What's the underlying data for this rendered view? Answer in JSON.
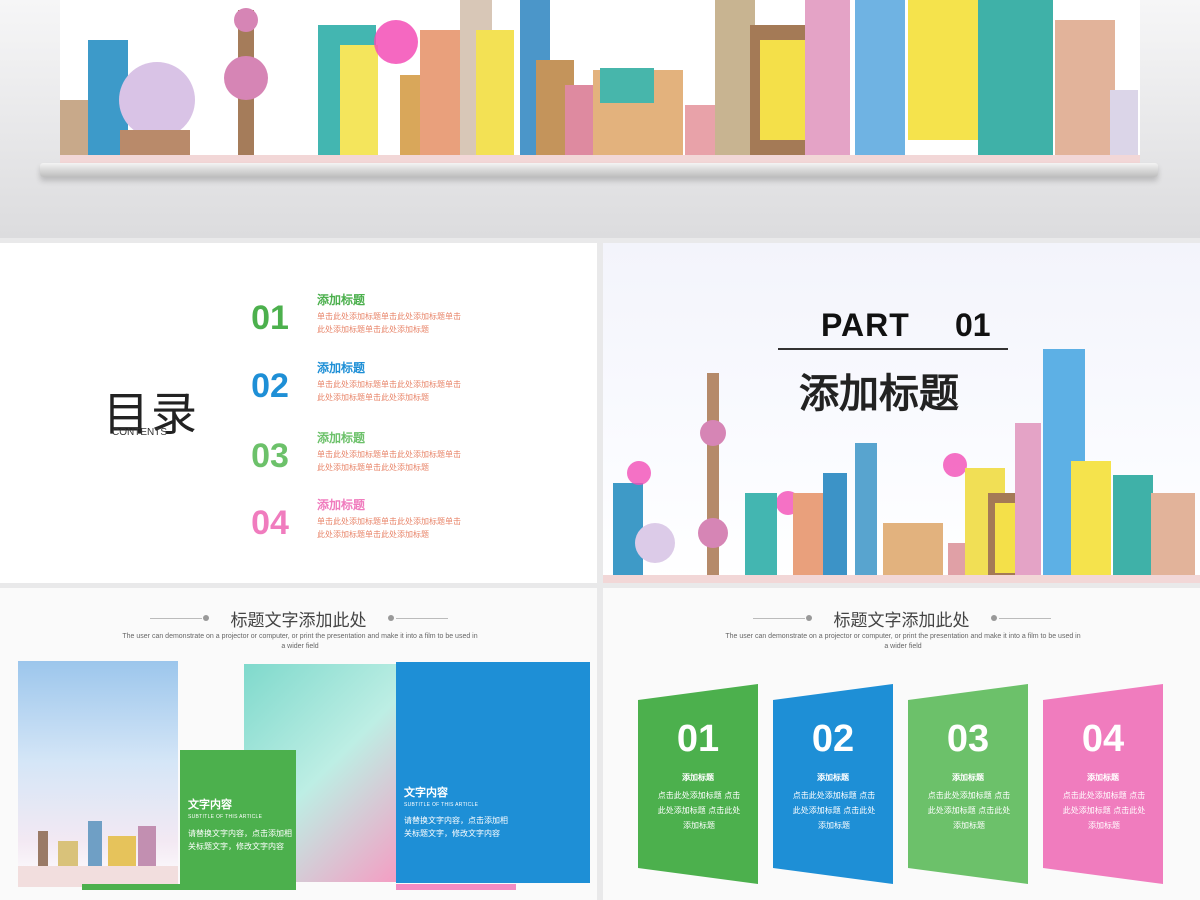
{
  "toc": {
    "title": "目录",
    "subtitle": "CONTENTS",
    "items": [
      {
        "num": "01",
        "heading": "添加标题",
        "desc": "单击此处添加标题单击此处添加标题单击此处添加标题单击此处添加标题",
        "color": "#4cb04d"
      },
      {
        "num": "02",
        "heading": "添加标题",
        "desc": "单击此处添加标题单击此处添加标题单击此处添加标题单击此处添加标题",
        "color": "#1e8fd6"
      },
      {
        "num": "03",
        "heading": "添加标题",
        "desc": "单击此处添加标题单击此处添加标题单击此处添加标题单击此处添加标题",
        "color": "#6cc16a"
      },
      {
        "num": "04",
        "heading": "添加标题",
        "desc": "单击此处添加标题单击此处添加标题单击此处添加标题单击此处添加标题",
        "color": "#f07cbe"
      }
    ]
  },
  "part": {
    "label": "PART",
    "num": "01",
    "title": "添加标题"
  },
  "slide3": {
    "header": "标题文字添加此处",
    "header_en": "The user can demonstrate on a projector or computer, or print the presentation and make it into a film to be used in a wider field",
    "box1": {
      "title": "文字内容",
      "sub": "SUBTITLE OF THIS ARTICLE",
      "text": "请替换文字内容，点击添加相关标题文字，修改文字内容"
    },
    "box2": {
      "title": "文字内容",
      "sub": "SUBTITLE OF THIS ARTICLE",
      "text": "请替换文字内容，点击添加相关标题文字，修改文字内容"
    }
  },
  "slide4": {
    "header": "标题文字添加此处",
    "header_en": "The user can demonstrate on a projector or computer, or print the presentation and make it into a film to be used in a wider field",
    "cards": [
      {
        "num": "01",
        "title": "添加标题",
        "desc": "点击此处添加标题 点击此处添加标题 点击此处添加标题"
      },
      {
        "num": "02",
        "title": "添加标题",
        "desc": "点击此处添加标题 点击此处添加标题 点击此处添加标题"
      },
      {
        "num": "03",
        "title": "添加标题",
        "desc": "点击此处添加标题 点击此处添加标题 点击此处添加标题"
      },
      {
        "num": "04",
        "title": "添加标题",
        "desc": "点击此处添加标题 点击此处添加标题 点击此处添加标题"
      }
    ]
  }
}
